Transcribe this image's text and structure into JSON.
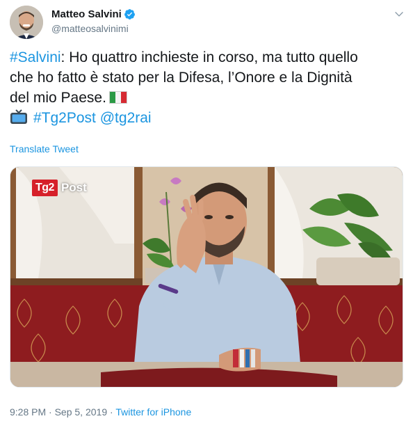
{
  "author": {
    "name": "Matteo Salvini",
    "handle": "@matteosalvinimi",
    "verified": true
  },
  "tweet": {
    "hashtag_lead": "#Salvini",
    "line1_rest": ": Ho quattro inchieste in corso, ma tutto quello",
    "line2": "che ho fatto è stato per la Difesa, l’Onore e la Dignità",
    "line3": "del mio Paese.",
    "flag_icon": "italy-flag-icon",
    "tv_icon": "television-icon",
    "hashtag_tg2post": "#Tg2Post",
    "mention_tg2rai": "@tg2rai"
  },
  "translate_label": "Translate Tweet",
  "media": {
    "logo_text": "Tg2",
    "logo_suffix": "Post"
  },
  "footer": {
    "time": "9:28 PM",
    "separator": " · ",
    "date": "Sep 5, 2019",
    "separator2": " · ",
    "source": "Twitter for iPhone"
  },
  "colors": {
    "link": "#1b95e0",
    "secondary_text": "#657786",
    "verified": "#1da1f2",
    "tg2_red": "#d6202a"
  }
}
